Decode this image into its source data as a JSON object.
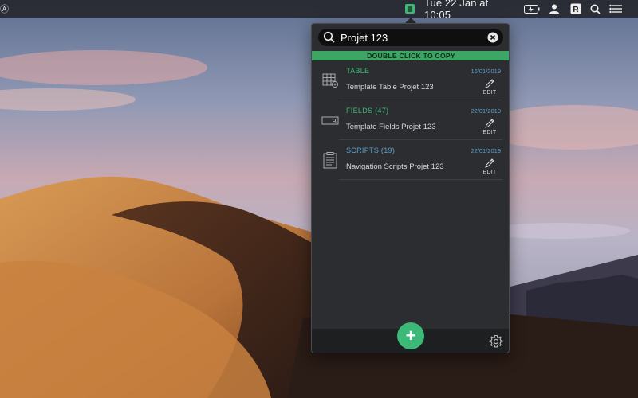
{
  "menubar": {
    "clock": "Tue 22 Jan at  10:05",
    "icons": [
      "app-icon",
      "battery-icon",
      "user-icon",
      "rapp-icon",
      "search-icon",
      "list-icon"
    ]
  },
  "popover": {
    "search": {
      "value": "Projet 123",
      "placeholder": ""
    },
    "copy_hint": "DOUBLE CLICK TO COPY",
    "rows": [
      {
        "type": "TABLE",
        "type_color": "#3cb878",
        "date": "16/01/2019",
        "title": "Template Table Projet 123",
        "edit_label": "EDIT",
        "icon": "table-icon"
      },
      {
        "type": "FIELDS (47)",
        "type_color": "#3cb878",
        "date": "22/01/2019",
        "title": "Template Fields Projet 123",
        "edit_label": "EDIT",
        "icon": "field-icon"
      },
      {
        "type": "SCRIPTS (19)",
        "type_color": "#5aa0c8",
        "date": "22/01/2019",
        "title": "Navigation Scripts Projet 123",
        "edit_label": "EDIT",
        "icon": "script-icon"
      }
    ],
    "add_label": "+",
    "colors": {
      "accent": "#3cb878",
      "date": "#5aa0c8",
      "panel": "#2c2d30"
    }
  }
}
